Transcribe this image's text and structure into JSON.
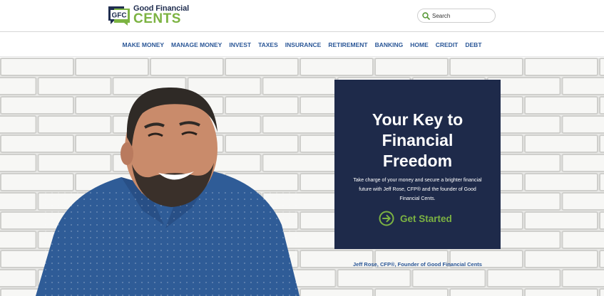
{
  "brand": {
    "logo_mark_text": "GFC",
    "name_line1": "Good Financial",
    "name_line2": "CENTS",
    "color_navy": "#1f2d4f",
    "color_green": "#7cb342"
  },
  "search": {
    "placeholder": "Search",
    "icon": "search-icon"
  },
  "nav": {
    "items": [
      {
        "label": "MAKE MONEY"
      },
      {
        "label": "MANAGE MONEY"
      },
      {
        "label": "INVEST"
      },
      {
        "label": "TAXES"
      },
      {
        "label": "INSURANCE"
      },
      {
        "label": "RETIREMENT"
      },
      {
        "label": "BANKING"
      },
      {
        "label": "HOME"
      },
      {
        "label": "CREDIT"
      },
      {
        "label": "DEBT"
      }
    ],
    "color": "#2b5797"
  },
  "hero": {
    "title": "Your Key to Financial Freedom",
    "body": "Take charge of your money and secure a brighter financial future with Jeff Rose, CFP® and the founder of Good Financial Cents.",
    "cta_label": "Get Started",
    "cta_icon": "arrow-right-circle-icon",
    "caption": "Jeff Rose, CFP®, Founder of Good Financial Cents",
    "card_color": "#1e2a4a"
  }
}
